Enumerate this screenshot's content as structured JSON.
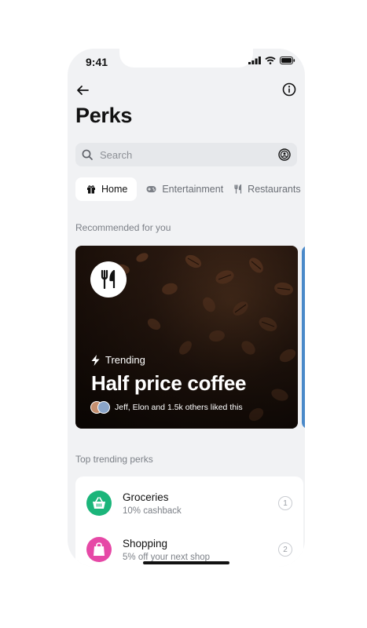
{
  "status_bar": {
    "time": "9:41"
  },
  "header": {
    "title": "Perks"
  },
  "search": {
    "placeholder": "Search"
  },
  "tabs": [
    {
      "label": "Home",
      "icon": "gift-icon",
      "active": true
    },
    {
      "label": "Entertainment",
      "icon": "gamepad-icon",
      "active": false
    },
    {
      "label": "Restaurants",
      "icon": "fork-knife-icon",
      "active": false
    }
  ],
  "recommended": {
    "section_label": "Recommended for you",
    "card": {
      "badge_icon": "fork-knife-icon",
      "tag": "Trending",
      "title": "Half price coffee",
      "likes_text": "Jeff, Elon and 1.5k others liked this"
    }
  },
  "top_trending": {
    "section_label": "Top trending perks",
    "items": [
      {
        "title": "Groceries",
        "subtitle": "10% cashback",
        "rank": "1",
        "icon": "basket-icon",
        "color": "#1bb57a"
      },
      {
        "title": "Shopping",
        "subtitle": "5% off your next shop",
        "rank": "2",
        "icon": "shopping-bag-icon",
        "color": "#e648a6"
      }
    ]
  },
  "colors": {
    "background": "#f1f2f4",
    "accent_blue": "#4a89c9"
  }
}
